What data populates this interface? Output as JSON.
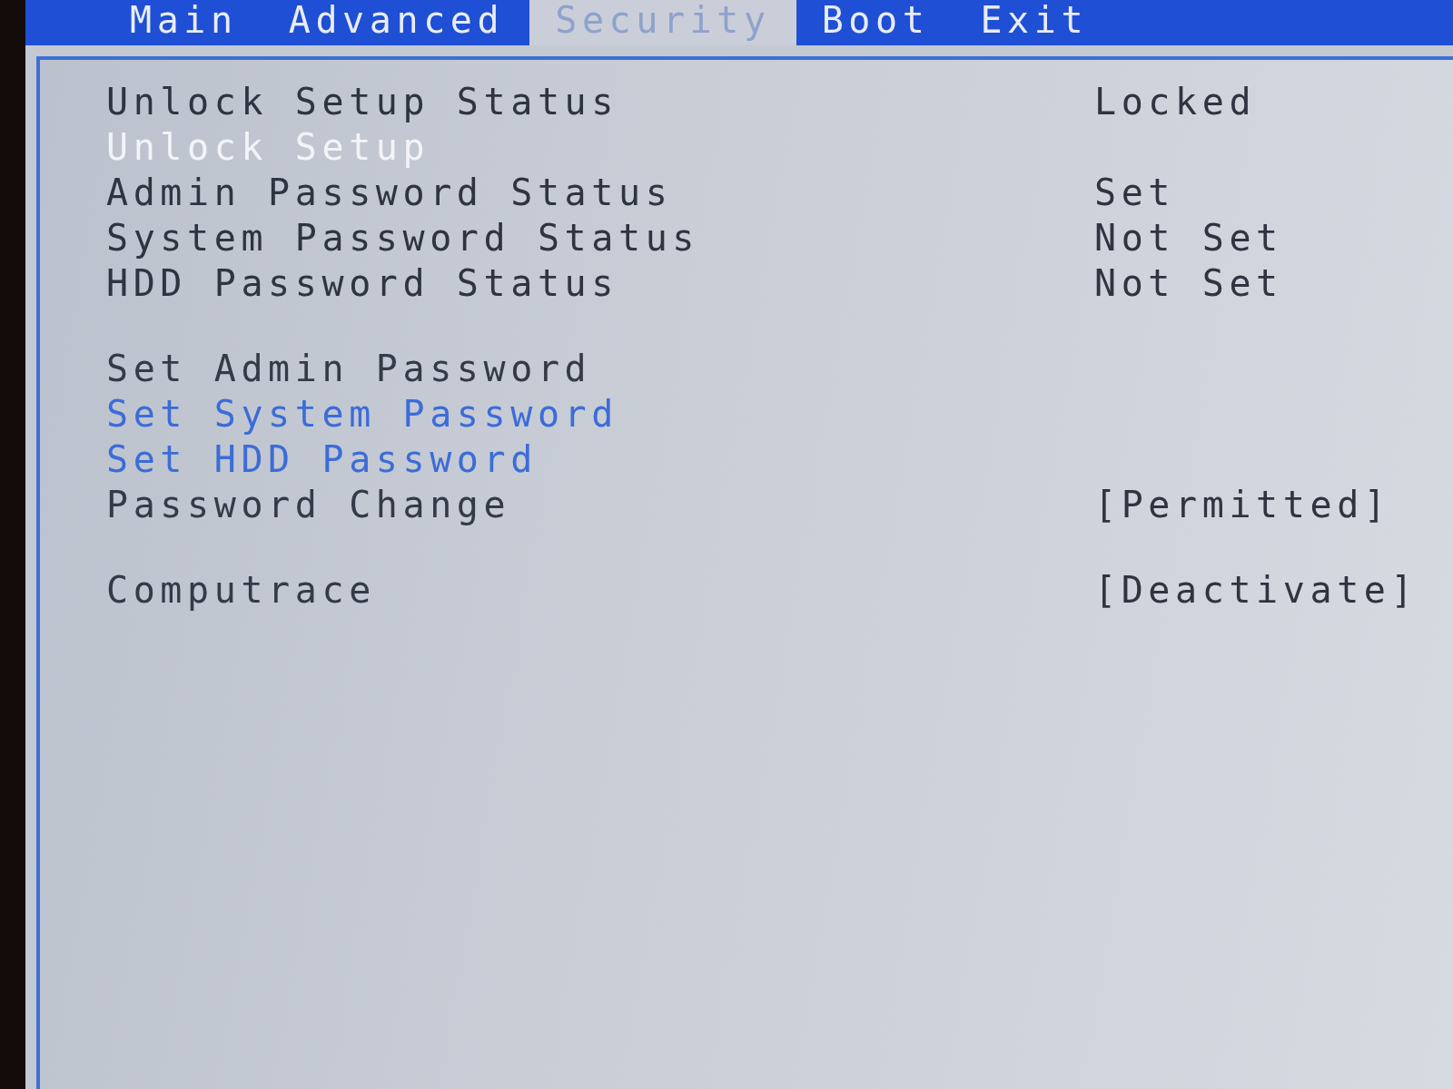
{
  "menu_bar": {
    "tabs": [
      {
        "label": "Main",
        "selected": false
      },
      {
        "label": "Advanced",
        "selected": false
      },
      {
        "label": "Security",
        "selected": true
      },
      {
        "label": "Boot",
        "selected": false
      },
      {
        "label": "Exit",
        "selected": false
      }
    ]
  },
  "groups": [
    {
      "items": [
        {
          "kind": "info",
          "label": "Unlock Setup Status",
          "value": "Locked"
        },
        {
          "kind": "option",
          "label": "Unlock Setup",
          "selected": true,
          "disabled": false
        },
        {
          "kind": "info",
          "label": "Admin Password Status",
          "value": "Set"
        },
        {
          "kind": "info",
          "label": "System Password Status",
          "value": "Not Set"
        },
        {
          "kind": "info",
          "label": "HDD Password Status",
          "value": "Not Set"
        }
      ]
    },
    {
      "items": [
        {
          "kind": "option",
          "label": "Set Admin Password",
          "selected": false,
          "disabled": true
        },
        {
          "kind": "option",
          "label": "Set System Password",
          "selected": false,
          "disabled": false
        },
        {
          "kind": "option",
          "label": "Set HDD Password",
          "selected": false,
          "disabled": false
        },
        {
          "kind": "option",
          "label": "Password Change",
          "value": "[Permitted]",
          "selected": false,
          "disabled": true
        }
      ]
    },
    {
      "items": [
        {
          "kind": "option",
          "label": "Computrace",
          "value": "[Deactivate]",
          "selected": false,
          "disabled": true
        }
      ]
    }
  ]
}
